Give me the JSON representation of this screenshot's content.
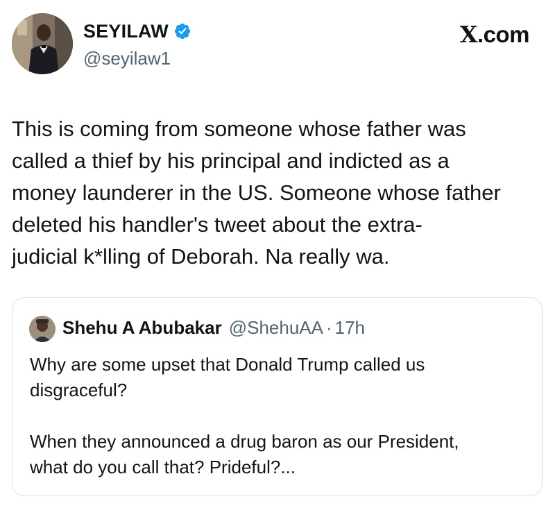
{
  "author": {
    "name": "SEYILAW",
    "handle": "@seyilaw1",
    "verified": true,
    "verified_color": "#1d9bf0"
  },
  "brand": {
    "x": "X",
    "domain": ".com"
  },
  "tweet": {
    "text": "This is coming from someone whose father was\ncalled a thief by his principal and indicted as a\nmoney launderer in the US. Someone whose father\ndeleted his handler's tweet about the extra-\njudicial k*lling of Deborah. Na really wa."
  },
  "quote": {
    "name": "Shehu A Abubakar",
    "handle": "@ShehuAA",
    "separator": "·",
    "time": "17h",
    "text": "Why are some upset that Donald Trump called us\ndisgraceful?\n\nWhen they announced a drug baron as our President,\nwhat do you call that? Prideful?..."
  },
  "icons": {
    "author_avatar": "profile-photo",
    "verified": "verified-badge-icon",
    "quote_avatar": "profile-photo"
  }
}
